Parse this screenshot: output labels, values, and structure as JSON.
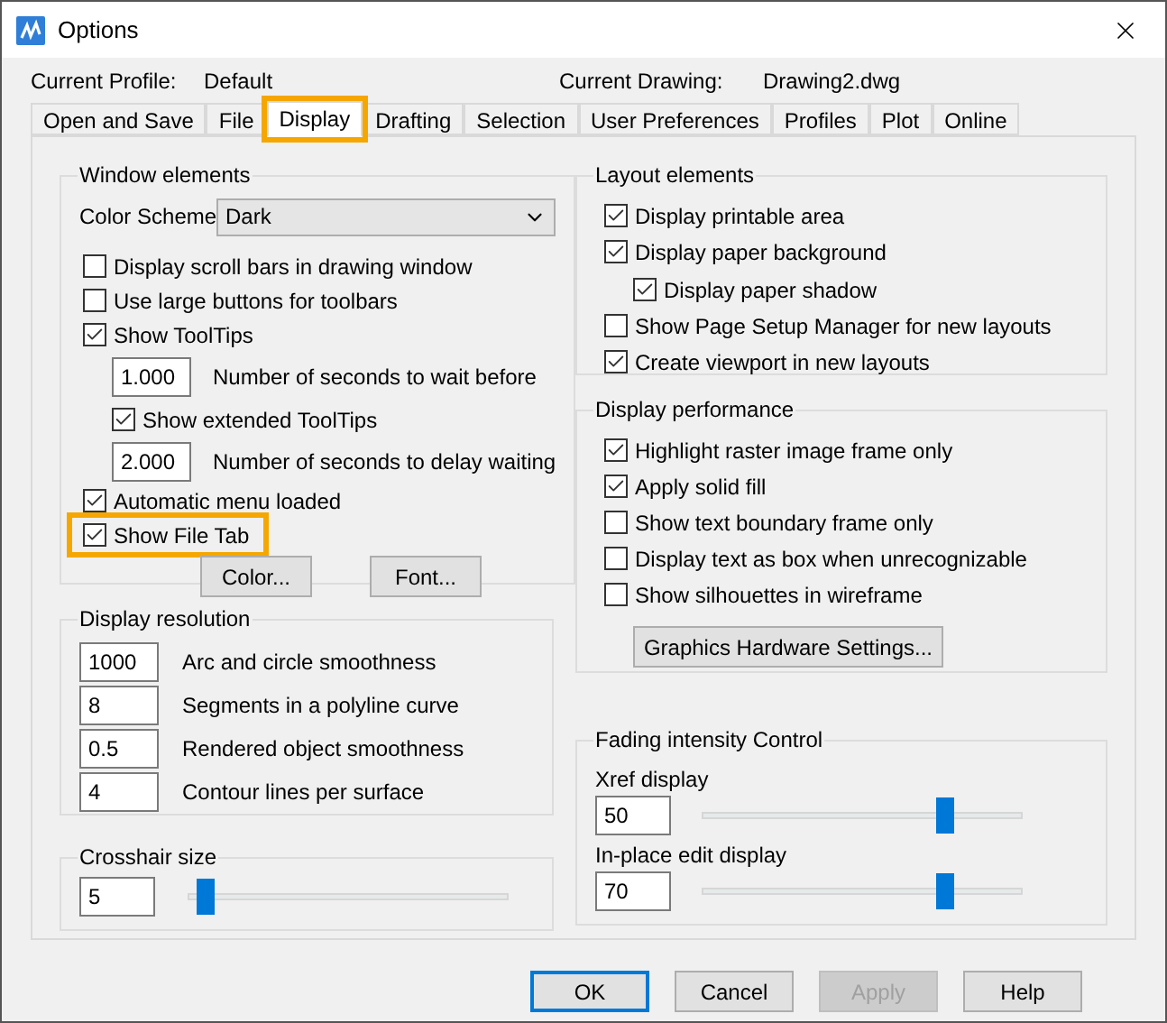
{
  "window": {
    "title": "Options"
  },
  "profile": {
    "label": "Current Profile:",
    "value": "Default"
  },
  "drawing": {
    "label": "Current Drawing:",
    "value": "Drawing2.dwg"
  },
  "tabs": [
    {
      "label": "Open and Save",
      "selected": false,
      "highlighted": false
    },
    {
      "label": "File",
      "selected": false,
      "highlighted": false
    },
    {
      "label": "Display",
      "selected": true,
      "highlighted": true
    },
    {
      "label": "Drafting",
      "selected": false,
      "highlighted": false
    },
    {
      "label": "Selection",
      "selected": false,
      "highlighted": false
    },
    {
      "label": "User Preferences",
      "selected": false,
      "highlighted": false
    },
    {
      "label": "Profiles",
      "selected": false,
      "highlighted": false
    },
    {
      "label": "Plot",
      "selected": false,
      "highlighted": false
    },
    {
      "label": "Online",
      "selected": false,
      "highlighted": false
    }
  ],
  "window_elements": {
    "title": "Window elements",
    "color_scheme": {
      "label": "Color Scheme",
      "value": "Dark"
    },
    "items": [
      {
        "kind": "checkbox",
        "label": "Display scroll bars in drawing window",
        "checked": false,
        "highlighted": false
      },
      {
        "kind": "checkbox",
        "label": "Use large buttons for toolbars",
        "checked": false,
        "highlighted": false
      },
      {
        "kind": "checkbox",
        "label": "Show ToolTips",
        "checked": true,
        "highlighted": false,
        "children": [
          {
            "kind": "field",
            "value": "1.000",
            "label": "Number of seconds to wait before"
          },
          {
            "kind": "checkbox",
            "label": "Show extended ToolTips",
            "checked": true,
            "highlighted": false
          },
          {
            "kind": "field",
            "value": "2.000",
            "label": "Number of seconds to delay waiting"
          }
        ]
      },
      {
        "kind": "checkbox",
        "label": "Automatic menu loaded",
        "checked": true,
        "highlighted": false
      },
      {
        "kind": "checkbox",
        "label": "Show File Tab",
        "checked": true,
        "highlighted": true
      }
    ],
    "buttons": [
      "Color...",
      "Font..."
    ]
  },
  "display_resolution": {
    "title": "Display resolution",
    "items": [
      {
        "value": "1000",
        "label": "Arc and circle smoothness"
      },
      {
        "value": "8",
        "label": "Segments in a polyline curve"
      },
      {
        "value": "0.5",
        "label": "Rendered object smoothness"
      },
      {
        "value": "4",
        "label": "Contour lines per surface"
      }
    ]
  },
  "crosshair": {
    "title": "Crosshair size",
    "value": "5",
    "level": 0.05
  },
  "layout_elements": {
    "title": "Layout elements",
    "items": [
      {
        "kind": "checkbox",
        "label": "Display printable area",
        "checked": true
      },
      {
        "kind": "checkbox",
        "label": "Display paper background",
        "checked": true,
        "children": [
          {
            "kind": "checkbox",
            "label": "Display paper shadow",
            "checked": true
          }
        ]
      },
      {
        "kind": "checkbox",
        "label": "Show Page Setup Manager for new layouts",
        "checked": false
      },
      {
        "kind": "checkbox",
        "label": "Create viewport in new layouts",
        "checked": true
      }
    ]
  },
  "display_performance": {
    "title": "Display performance",
    "items": [
      {
        "kind": "checkbox",
        "label": "Highlight raster image frame only",
        "checked": true
      },
      {
        "kind": "checkbox",
        "label": "Apply solid fill",
        "checked": true
      },
      {
        "kind": "checkbox",
        "label": "Show text boundary frame only",
        "checked": false
      },
      {
        "kind": "checkbox",
        "label": "Display text as box when unrecognizable",
        "checked": false
      },
      {
        "kind": "checkbox",
        "label": "Show silhouettes in wireframe",
        "checked": false
      }
    ],
    "button": "Graphics Hardware Settings..."
  },
  "fading": {
    "title": "Fading intensity Control",
    "sliders": [
      {
        "label": "Xref display",
        "value": "50",
        "level": 0.76
      },
      {
        "label": "In-place edit display",
        "value": "70",
        "level": 0.76
      }
    ]
  },
  "buttons": [
    {
      "label": "OK",
      "default": true,
      "disabled": false
    },
    {
      "label": "Cancel",
      "default": false,
      "disabled": false
    },
    {
      "label": "Apply",
      "default": false,
      "disabled": true
    },
    {
      "label": "Help",
      "default": false,
      "disabled": false
    }
  ]
}
